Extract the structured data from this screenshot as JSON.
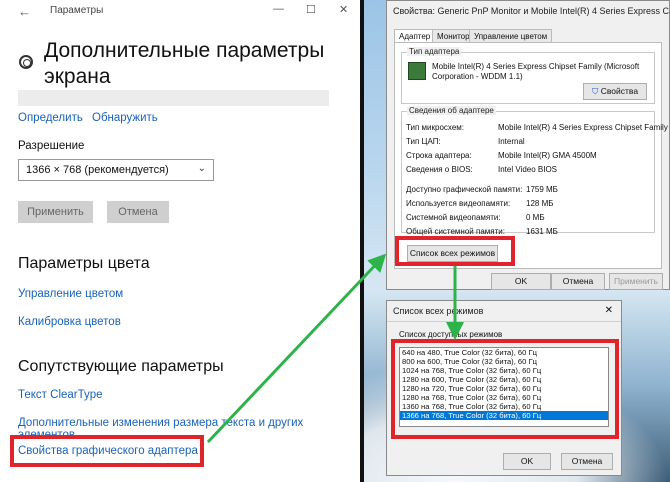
{
  "settings": {
    "window_title": "Параметры",
    "back_glyph": "←",
    "controls": [
      "—",
      "☐",
      "✕"
    ],
    "page_title": "Дополнительные параметры экрана",
    "links_top": [
      "Определить",
      "Обнаружить"
    ],
    "resolution_label": "Разрешение",
    "resolution_value": "1366 × 768 (рекомендуется)",
    "apply_label": "Применить",
    "cancel_label": "Отмена",
    "color_header": "Параметры цвета",
    "color_links": [
      "Управление цветом",
      "Калибровка цветов"
    ],
    "related_header": "Сопутствующие параметры",
    "related_links": [
      "Текст ClearType",
      "Дополнительные изменения размера текста и других элементов",
      "Свойства графического адаптера"
    ]
  },
  "props": {
    "title": "Свойства: Generic PnP Monitor и Mobile Intel(R) 4 Series Express C...",
    "tabs": [
      "Адаптер",
      "Монитор",
      "Управление цветом"
    ],
    "adapter_type_group": "Тип адаптера",
    "adapter_name": "Mobile Intel(R) 4 Series Express Chipset Family (Microsoft Corporation - WDDM 1.1)",
    "properties_button": "Свойства",
    "adapter_info_group": "Сведения об адаптере",
    "info_rows": [
      {
        "k": "Тип микросхем:",
        "v": "Mobile Intel(R) 4 Series Express Chipset Family"
      },
      {
        "k": "Тип ЦАП:",
        "v": "Internal"
      },
      {
        "k": "Строка адаптера:",
        "v": "Mobile Intel(R) GMA 4500M"
      },
      {
        "k": "Сведения о BIOS:",
        "v": "Intel Video BIOS"
      }
    ],
    "mem_rows": [
      {
        "k": "Доступно графической памяти:",
        "v": "1759 МБ"
      },
      {
        "k": "Используется видеопамяти:",
        "v": "128 МБ"
      },
      {
        "k": "Системной видеопамяти:",
        "v": "0 МБ"
      },
      {
        "k": "Общей системной памяти:",
        "v": "1631 МБ"
      }
    ],
    "list_modes_button": "Список всех режимов",
    "ok": "OK",
    "cancel": "Отмена",
    "apply": "Применить"
  },
  "modes": {
    "title": "Список всех режимов",
    "close_glyph": "✕",
    "group_label": "Список доступных режимов",
    "items": [
      "640 на 480, True Color (32 бита), 60 Гц",
      "800 на 600, True Color (32 бита), 60 Гц",
      "1024 на 768, True Color (32 бита), 60 Гц",
      "1280 на 600, True Color (32 бита), 60 Гц",
      "1280 на 720, True Color (32 бита), 60 Гц",
      "1280 на 768, True Color (32 бита), 60 Гц",
      "1360 на 768, True Color (32 бита), 60 Гц",
      "1366 на 768, True Color (32 бита), 60 Гц"
    ],
    "selected_index": 7,
    "ok": "OK",
    "cancel": "Отмена"
  },
  "colors": {
    "link": "#1a63b3",
    "highlight_box": "#e0242c",
    "arrow": "#2db34a",
    "selection": "#0078d7"
  }
}
